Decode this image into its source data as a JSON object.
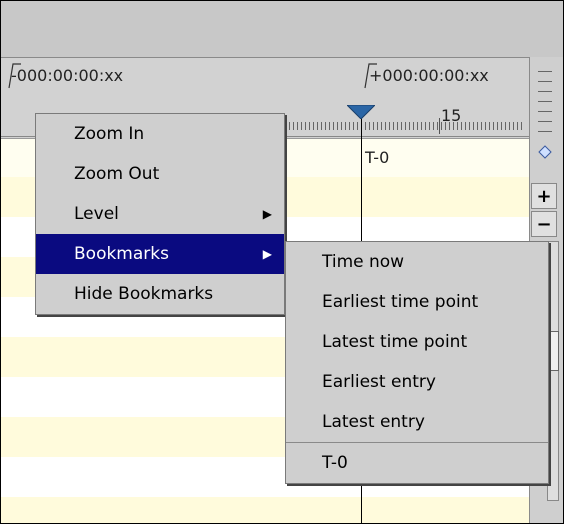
{
  "ruler": {
    "left_time": "-000:00:00:xx",
    "right_time": "+000:00:00:xx",
    "tick_number": "15",
    "marker_label": "T-0"
  },
  "right_strip": {
    "plus_label": "+",
    "minus_label": "−"
  },
  "context_menu": {
    "items": [
      {
        "label": "Zoom In"
      },
      {
        "label": "Zoom Out"
      },
      {
        "label": "Level"
      },
      {
        "label": "Bookmarks"
      },
      {
        "label": "Hide Bookmarks"
      }
    ]
  },
  "submenu": {
    "items": [
      {
        "label": "Time now"
      },
      {
        "label": "Earliest time point"
      },
      {
        "label": "Latest time point"
      },
      {
        "label": "Earliest entry"
      },
      {
        "label": "Latest entry"
      },
      {
        "label": "T-0"
      }
    ]
  },
  "colors": {
    "selected_bg": "#0a0a80",
    "menu_bg": "#cfcfcf",
    "row_yellow": "#fffbdc",
    "marker": "#2b66a6"
  }
}
